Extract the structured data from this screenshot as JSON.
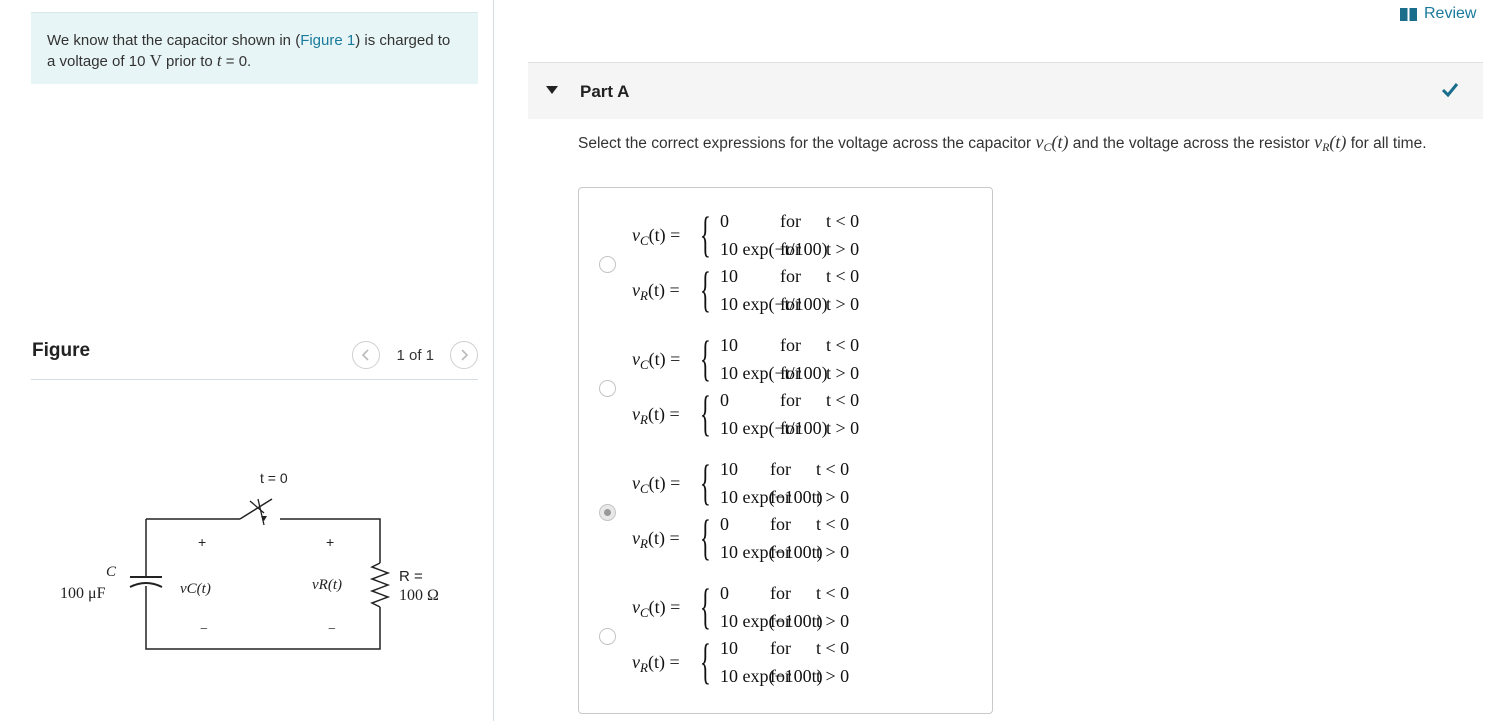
{
  "intro": {
    "text_before": "We know that the capacitor shown in (",
    "figure_link": "Figure 1",
    "text_mid": ") is charged to a voltage of 10 ",
    "unit": "V",
    "text_mid2": " prior to ",
    "var": "t",
    "text_after": " = 0."
  },
  "figure": {
    "title": "Figure",
    "pager": "1 of 1",
    "prev_icon": "chevron-left-icon",
    "next_icon": "chevron-right-icon",
    "circuit": {
      "switch_label": "t = 0",
      "cap_label": "C",
      "cap_value": "100 μF",
      "vc_label": "vC(t)",
      "vr_label": "vR(t)",
      "plus": "+",
      "minus": "−",
      "res_label": "R =",
      "res_value": "100 Ω"
    }
  },
  "header": {
    "review_label": "Review",
    "review_icon": "book-icon"
  },
  "part": {
    "title": "Part A",
    "caret_icon": "caret-down-icon",
    "status_icon": "checkmark-icon",
    "status_color": "#1a6e8c"
  },
  "question": {
    "text1": "Select the correct expressions for the voltage across the capacitor ",
    "vc": "v",
    "vc_sub": "C",
    "vc_arg": "(t)",
    "text2": " and the voltage across the resistor ",
    "vr": "v",
    "vr_sub": "R",
    "vr_arg": "(t)",
    "text3": " for all time."
  },
  "options": [
    {
      "selected": false,
      "vc": [
        [
          "0",
          "for",
          "t < 0"
        ],
        [
          "10 exp(−t/100)",
          "for",
          "t > 0"
        ]
      ],
      "vr": [
        [
          "10",
          "for",
          "t < 0"
        ],
        [
          "10 exp(−t/100)",
          "for",
          "t > 0"
        ]
      ]
    },
    {
      "selected": false,
      "vc": [
        [
          "10",
          "for",
          "t < 0"
        ],
        [
          "10 exp(−t/100)",
          "for",
          "t > 0"
        ]
      ],
      "vr": [
        [
          "0",
          "for",
          "t < 0"
        ],
        [
          "10 exp(−t/100)",
          "for",
          "t > 0"
        ]
      ]
    },
    {
      "selected": true,
      "vc": [
        [
          "10",
          "for",
          "t < 0"
        ],
        [
          "10 exp(−100t)",
          "for",
          "t > 0"
        ]
      ],
      "vr": [
        [
          "0",
          "for",
          "t < 0"
        ],
        [
          "10 exp(−100t)",
          "for",
          "t > 0"
        ]
      ]
    },
    {
      "selected": false,
      "vc": [
        [
          "0",
          "for",
          "t < 0"
        ],
        [
          "10 exp(−100t)",
          "for",
          "t > 0"
        ]
      ],
      "vr": [
        [
          "10",
          "for",
          "t < 0"
        ],
        [
          "10 exp(−100t)",
          "for",
          "t > 0"
        ]
      ]
    }
  ],
  "eqn_labels": {
    "v": "v",
    "sub_c": "C",
    "sub_r": "R",
    "arg": "(t) ="
  }
}
